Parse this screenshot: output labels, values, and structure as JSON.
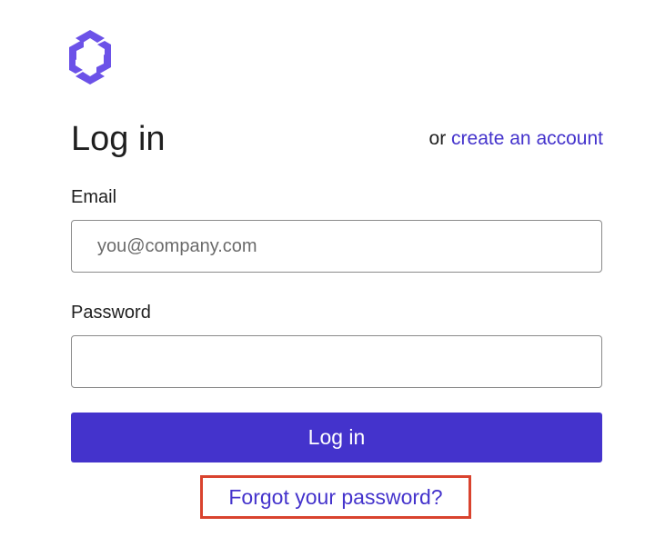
{
  "brand": {
    "logo_icon": "hexagon-logo-icon",
    "accent_color": "#4433cc",
    "logo_color": "#6c52e8"
  },
  "login": {
    "title": "Log in",
    "alt_prefix": "or",
    "alt_link_label": "create an account"
  },
  "form": {
    "email_label": "Email",
    "email_value": "",
    "email_placeholder": "you@company.com",
    "password_label": "Password",
    "password_value": "",
    "password_placeholder": "",
    "submit_label": "Log in",
    "forgot_label": "Forgot your password?",
    "highlight_color": "#d9432e"
  }
}
